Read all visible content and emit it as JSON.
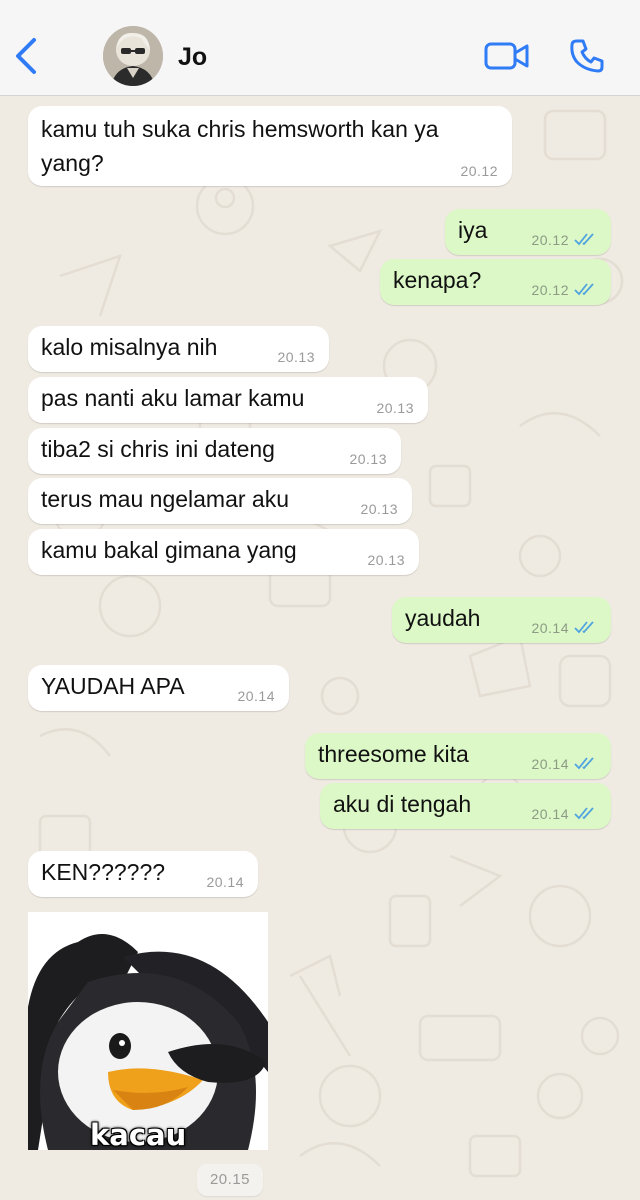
{
  "header": {
    "contact_name": "Jo",
    "back_icon": "chevron-left-icon",
    "video_icon": "video-camera-icon",
    "call_icon": "phone-icon"
  },
  "colors": {
    "accent": "#2f7cf6",
    "incoming_bubble": "#ffffff",
    "outgoing_bubble": "#dcf8c6",
    "chat_background": "#efeae2",
    "read_ticks": "#4fa3e0"
  },
  "messages": [
    {
      "dir": "in",
      "text": "kamu tuh suka chris hemsworth kan ya yang?",
      "time": "20.12"
    },
    {
      "dir": "out",
      "text": "iya",
      "time": "20.12",
      "status": "read"
    },
    {
      "dir": "out",
      "text": "kenapa?",
      "time": "20.12",
      "status": "read"
    },
    {
      "dir": "in",
      "text": "kalo misalnya nih",
      "time": "20.13"
    },
    {
      "dir": "in",
      "text": "pas nanti aku lamar kamu",
      "time": "20.13"
    },
    {
      "dir": "in",
      "text": "tiba2 si chris ini dateng",
      "time": "20.13"
    },
    {
      "dir": "in",
      "text": "terus mau ngelamar aku",
      "time": "20.13"
    },
    {
      "dir": "in",
      "text": "kamu bakal gimana yang",
      "time": "20.13"
    },
    {
      "dir": "out",
      "text": "yaudah",
      "time": "20.14",
      "status": "read"
    },
    {
      "dir": "in",
      "text": "YAUDAH APA",
      "time": "20.14"
    },
    {
      "dir": "out",
      "text": "threesome kita",
      "time": "20.14",
      "status": "read"
    },
    {
      "dir": "out",
      "text": "aku di tengah",
      "time": "20.14",
      "status": "read"
    },
    {
      "dir": "in",
      "text": "KEN??????",
      "time": "20.14"
    }
  ],
  "sticker": {
    "caption": "kacau",
    "time": "20.15"
  }
}
